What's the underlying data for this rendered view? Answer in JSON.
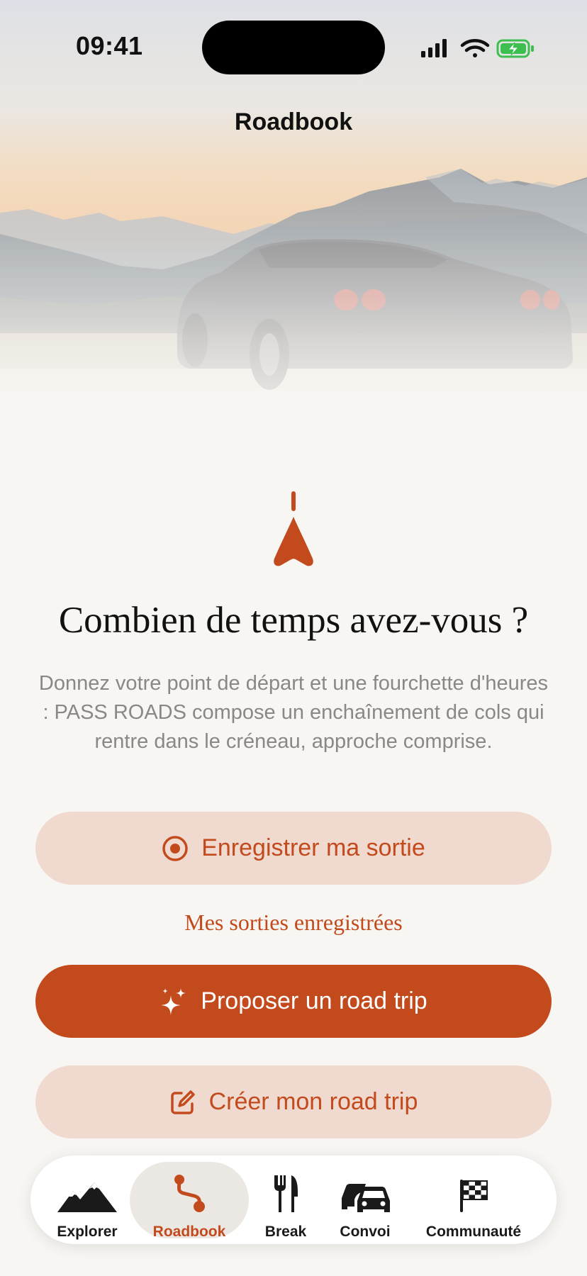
{
  "status": {
    "time": "09:41"
  },
  "nav": {
    "title": "Roadbook"
  },
  "main": {
    "headline": "Combien de temps avez-vous ?",
    "description": "Donnez votre point de départ et une fourchette d'heures : PASS ROADS compose un enchaînement de cols qui rentre dans le créneau, approche comprise.",
    "record_label": "Enregistrer ma sortie",
    "saved_link": "Mes sorties enregistrées",
    "propose_label": "Proposer un road trip",
    "create_label": "Créer mon road trip"
  },
  "tabbar": {
    "items": [
      {
        "label": "Explorer",
        "icon": "mountains-icon",
        "active": false
      },
      {
        "label": "Roadbook",
        "icon": "route-icon",
        "active": true
      },
      {
        "label": "Break",
        "icon": "fork-knife-icon",
        "active": false
      },
      {
        "label": "Convoi",
        "icon": "cars-icon",
        "active": false
      },
      {
        "label": "Communauté",
        "icon": "checkered-flag-icon",
        "active": false
      }
    ]
  },
  "colors": {
    "accent": "#c24a1c",
    "accent_light": "#f0d9cf",
    "background": "#f8f6f3"
  }
}
